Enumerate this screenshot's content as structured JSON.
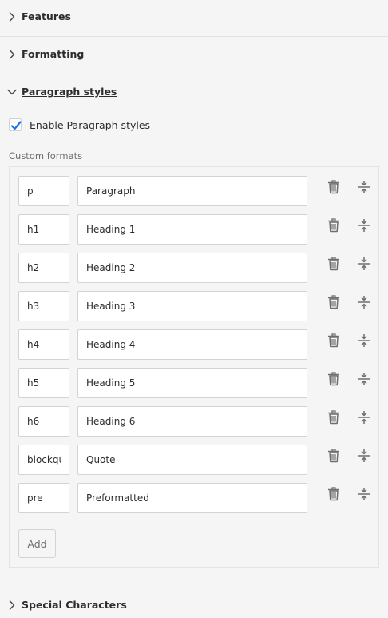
{
  "sections": {
    "features": {
      "title": "Features",
      "expanded": false
    },
    "formatting": {
      "title": "Formatting",
      "expanded": false
    },
    "paragraph_styles": {
      "title": "Paragraph styles",
      "expanded": true
    },
    "special_characters": {
      "title": "Special Characters",
      "expanded": false
    }
  },
  "paragraph_styles": {
    "enable_label": "Enable Paragraph styles",
    "enabled": true,
    "custom_formats_label": "Custom formats",
    "formats": [
      {
        "tag": "p",
        "name": "Paragraph"
      },
      {
        "tag": "h1",
        "name": "Heading 1"
      },
      {
        "tag": "h2",
        "name": "Heading 2"
      },
      {
        "tag": "h3",
        "name": "Heading 3"
      },
      {
        "tag": "h4",
        "name": "Heading 4"
      },
      {
        "tag": "h5",
        "name": "Heading 5"
      },
      {
        "tag": "h6",
        "name": "Heading 6"
      },
      {
        "tag": "blockquote",
        "name": "Quote"
      },
      {
        "tag": "pre",
        "name": "Preformatted"
      }
    ],
    "add_label": "Add"
  },
  "icons": {
    "collapsed": "chevron-right-icon",
    "expanded": "chevron-down-icon",
    "checkbox": "checkmark-icon",
    "delete": "trash-icon",
    "reorder": "move-vertical-icon"
  },
  "colors": {
    "accent": "#1473e6",
    "text": "#2c2c2c",
    "muted": "#6e6e6e",
    "icon": "#6e6e6e",
    "background": "#f5f5f5",
    "border": "#d3d3d3"
  }
}
